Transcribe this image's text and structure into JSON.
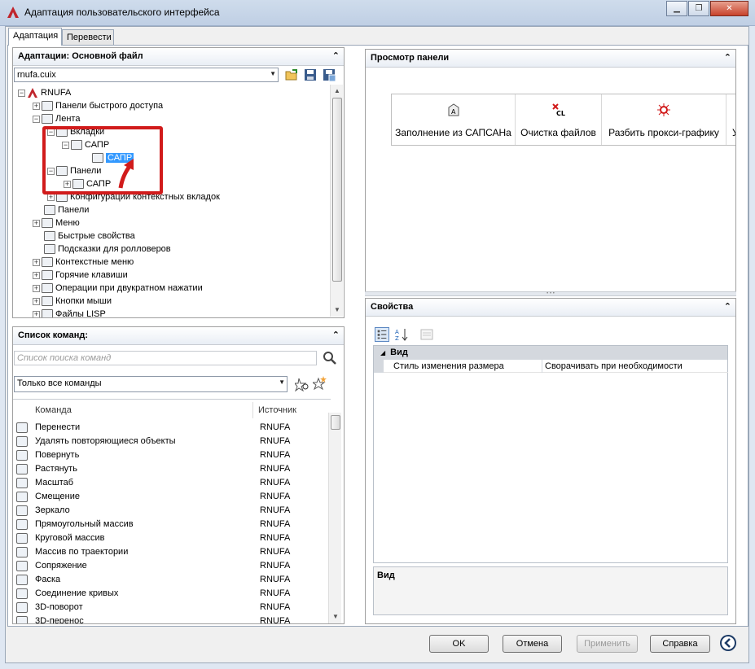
{
  "window": {
    "title": "Адаптация пользовательского интерфейса",
    "min": "",
    "restore": "",
    "close": ""
  },
  "tabs": [
    {
      "label": "Адаптация"
    },
    {
      "label": "Перевести"
    }
  ],
  "customizations": {
    "header": "Адаптации: Основной файл",
    "file_combo": "rnufa.cuix",
    "tree": [
      {
        "label": "RNUFA"
      },
      {
        "label": "Панели быстрого доступа"
      },
      {
        "label": "Лента"
      },
      {
        "label": "Вкладки"
      },
      {
        "label": "САПР"
      },
      {
        "label": "САПР"
      },
      {
        "label": "Панели"
      },
      {
        "label": "САПР"
      },
      {
        "label": "Конфигурации контекстных вкладок"
      },
      {
        "label": "Панели"
      },
      {
        "label": "Меню"
      },
      {
        "label": "Быстрые свойства"
      },
      {
        "label": "Подсказки для ролловеров"
      },
      {
        "label": "Контекстные меню"
      },
      {
        "label": "Горячие клавиши"
      },
      {
        "label": "Операции при двукратном нажатии"
      },
      {
        "label": "Кнопки мыши"
      },
      {
        "label": "Файлы LISP"
      }
    ]
  },
  "commands": {
    "header": "Список команд:",
    "search_placeholder": "Список поиска команд",
    "filter_combo": "Только все команды",
    "col_command": "Команда",
    "col_source": "Источник",
    "rows": [
      {
        "name": "Перенести",
        "source": "RNUFA"
      },
      {
        "name": "Удалять повторяющиеся объекты",
        "source": "RNUFA"
      },
      {
        "name": "Повернуть",
        "source": "RNUFA"
      },
      {
        "name": "Растянуть",
        "source": "RNUFA"
      },
      {
        "name": "Масштаб",
        "source": "RNUFA"
      },
      {
        "name": "Смещение",
        "source": "RNUFA"
      },
      {
        "name": "Зеркало",
        "source": "RNUFA"
      },
      {
        "name": "Прямоугольный массив",
        "source": "RNUFA"
      },
      {
        "name": "Круговой массив",
        "source": "RNUFA"
      },
      {
        "name": "Массив по траектории",
        "source": "RNUFA"
      },
      {
        "name": "Сопряжение",
        "source": "RNUFA"
      },
      {
        "name": "Фаска",
        "source": "RNUFA"
      },
      {
        "name": "Соединение кривых",
        "source": "RNUFA"
      },
      {
        "name": "3D-поворот",
        "source": "RNUFA"
      },
      {
        "name": "3D-перенос",
        "source": "RNUFA"
      }
    ]
  },
  "panel_preview": {
    "header": "Просмотр панели",
    "buttons": [
      {
        "label": "Заполнение из САПСАНа"
      },
      {
        "label": "Очистка файлов"
      },
      {
        "label": "Разбить прокси-графику"
      },
      {
        "label": "У"
      }
    ]
  },
  "properties": {
    "header": "Свойства",
    "category": "Вид",
    "rows": [
      {
        "name": "Стиль изменения размера",
        "value": "Сворачивать при необходимости"
      }
    ],
    "description_title": "Вид"
  },
  "buttons": {
    "ok": "OK",
    "cancel": "Отмена",
    "apply": "Применить",
    "help": "Справка"
  },
  "colors": {
    "accent": "#3399ff",
    "highlight_box": "#d11b1b"
  }
}
